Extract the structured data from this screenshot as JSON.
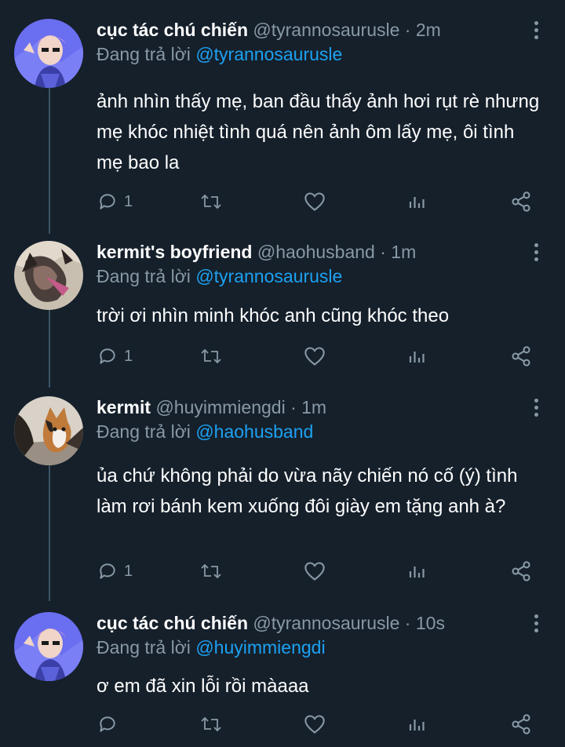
{
  "tweets": [
    {
      "name": "cục tác chú chiến",
      "handle": "@tyrannosaurusle",
      "time": "2m",
      "replying_label": "Đang trả lời",
      "replying_to": "@tyrannosaurusle",
      "text": "ảnh nhìn thấy mẹ, ban đầu thấy ảnh hơi rụt rè nhưng mẹ khóc nhiệt tình quá nên ảnh ôm lấy mẹ, ôi tình mẹ bao la",
      "reply_count": "1",
      "avatar": "pink-haired-person-avatar"
    },
    {
      "name": "kermit's boyfriend",
      "handle": "@haohusband",
      "time": "1m",
      "replying_label": "Đang trả lời",
      "replying_to": "@tyrannosaurusle",
      "text": "trời ơi nhìn minh khóc anh cũng khóc theo",
      "reply_count": "1",
      "avatar": "blurry-cat-avatar"
    },
    {
      "name": "kermit",
      "handle": "@huyimmiengdi",
      "time": "1m",
      "replying_label": "Đang trả lời",
      "replying_to": "@haohusband",
      "text": "ủa chứ không phải do vừa nãy chiến nó cố (ý) tình làm rơi bánh kem xuống đôi giày em tặng anh à?",
      "reply_count": "1",
      "avatar": "calico-cat-avatar"
    },
    {
      "name": "cục tác chú chiến",
      "handle": "@tyrannosaurusle",
      "time": "10s",
      "replying_label": "Đang trả lời",
      "replying_to": "@huyimmiengdi",
      "text": "ơ em đã xin lỗi rồi màaaa",
      "reply_count": "",
      "avatar": "pink-haired-person-avatar"
    }
  ],
  "separator": "·",
  "icons": {
    "reply": "reply-icon",
    "retweet": "retweet-icon",
    "like": "heart-icon",
    "analytics": "analytics-icon",
    "share": "share-icon",
    "more": "more-options-icon"
  },
  "colors": {
    "background": "#15202b",
    "text": "#ffffff",
    "secondary": "#8899a6",
    "link": "#1da1f2",
    "thread_line": "#3d5466"
  }
}
